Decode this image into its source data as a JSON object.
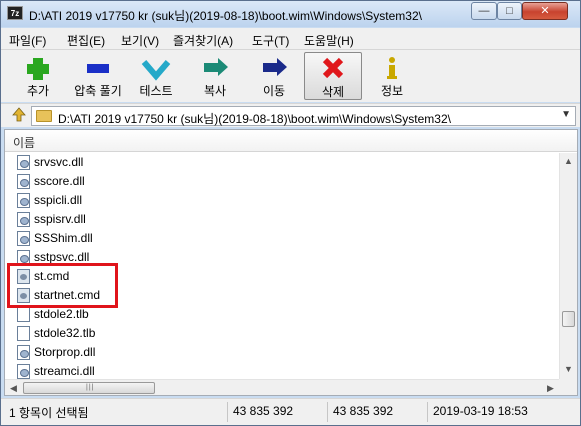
{
  "window": {
    "app_icon": "7z",
    "title": "D:\\ATI 2019 v17750 kr (suk님)(2019-08-18)\\boot.wim\\Windows\\System32\\",
    "minimize_glyph": "—",
    "maximize_glyph": "□",
    "close_glyph": "✕"
  },
  "menu": {
    "items": [
      "파일(F)",
      "편집(E)",
      "보기(V)",
      "즐겨찾기(A)",
      "도구(T)",
      "도움말(H)"
    ]
  },
  "toolbar": {
    "buttons": [
      {
        "label": "추가",
        "icon": "plus-icon",
        "color": "#2aa71f"
      },
      {
        "label": "압축 풀기",
        "icon": "minus-icon",
        "color": "#1a2fc7"
      },
      {
        "label": "테스트",
        "icon": "check-icon",
        "color": "#25a9c9"
      },
      {
        "label": "복사",
        "icon": "copy-arrow-icon",
        "color": "#1b8a76"
      },
      {
        "label": "이동",
        "icon": "move-arrow-icon",
        "color": "#1a2a8a"
      },
      {
        "label": "삭제",
        "icon": "delete-x-icon",
        "color": "#e0171b"
      },
      {
        "label": "정보",
        "icon": "info-icon",
        "color": "#c9a800"
      }
    ]
  },
  "address": {
    "path": "D:\\ATI 2019 v17750 kr (suk님)(2019-08-18)\\boot.wim\\Windows\\System32\\",
    "dropdown_glyph": "▼"
  },
  "list": {
    "column_name": "이름",
    "files": [
      {
        "name": "srvsvc.dll",
        "type": "dll"
      },
      {
        "name": "sscore.dll",
        "type": "dll"
      },
      {
        "name": "sspicli.dll",
        "type": "dll"
      },
      {
        "name": "sspisrv.dll",
        "type": "dll"
      },
      {
        "name": "SSShim.dll",
        "type": "dll"
      },
      {
        "name": "sstpsvc.dll",
        "type": "dll"
      },
      {
        "name": "st.cmd",
        "type": "cmd"
      },
      {
        "name": "startnet.cmd",
        "type": "cmd"
      },
      {
        "name": "stdole2.tlb",
        "type": "blank"
      },
      {
        "name": "stdole32.tlb",
        "type": "blank"
      },
      {
        "name": "Storprop.dll",
        "type": "dll"
      },
      {
        "name": "streamci.dll",
        "type": "dll"
      }
    ],
    "highlight_color": "#e0141b"
  },
  "scroll": {
    "up": "▲",
    "down": "▼",
    "left": "◀",
    "right": "▶",
    "grip": "|||"
  },
  "status": {
    "selection": "1 항목이 선택됨",
    "size": "43 835 392",
    "packed_size": "43 835 392",
    "modified": "2019-03-19 18:53"
  }
}
